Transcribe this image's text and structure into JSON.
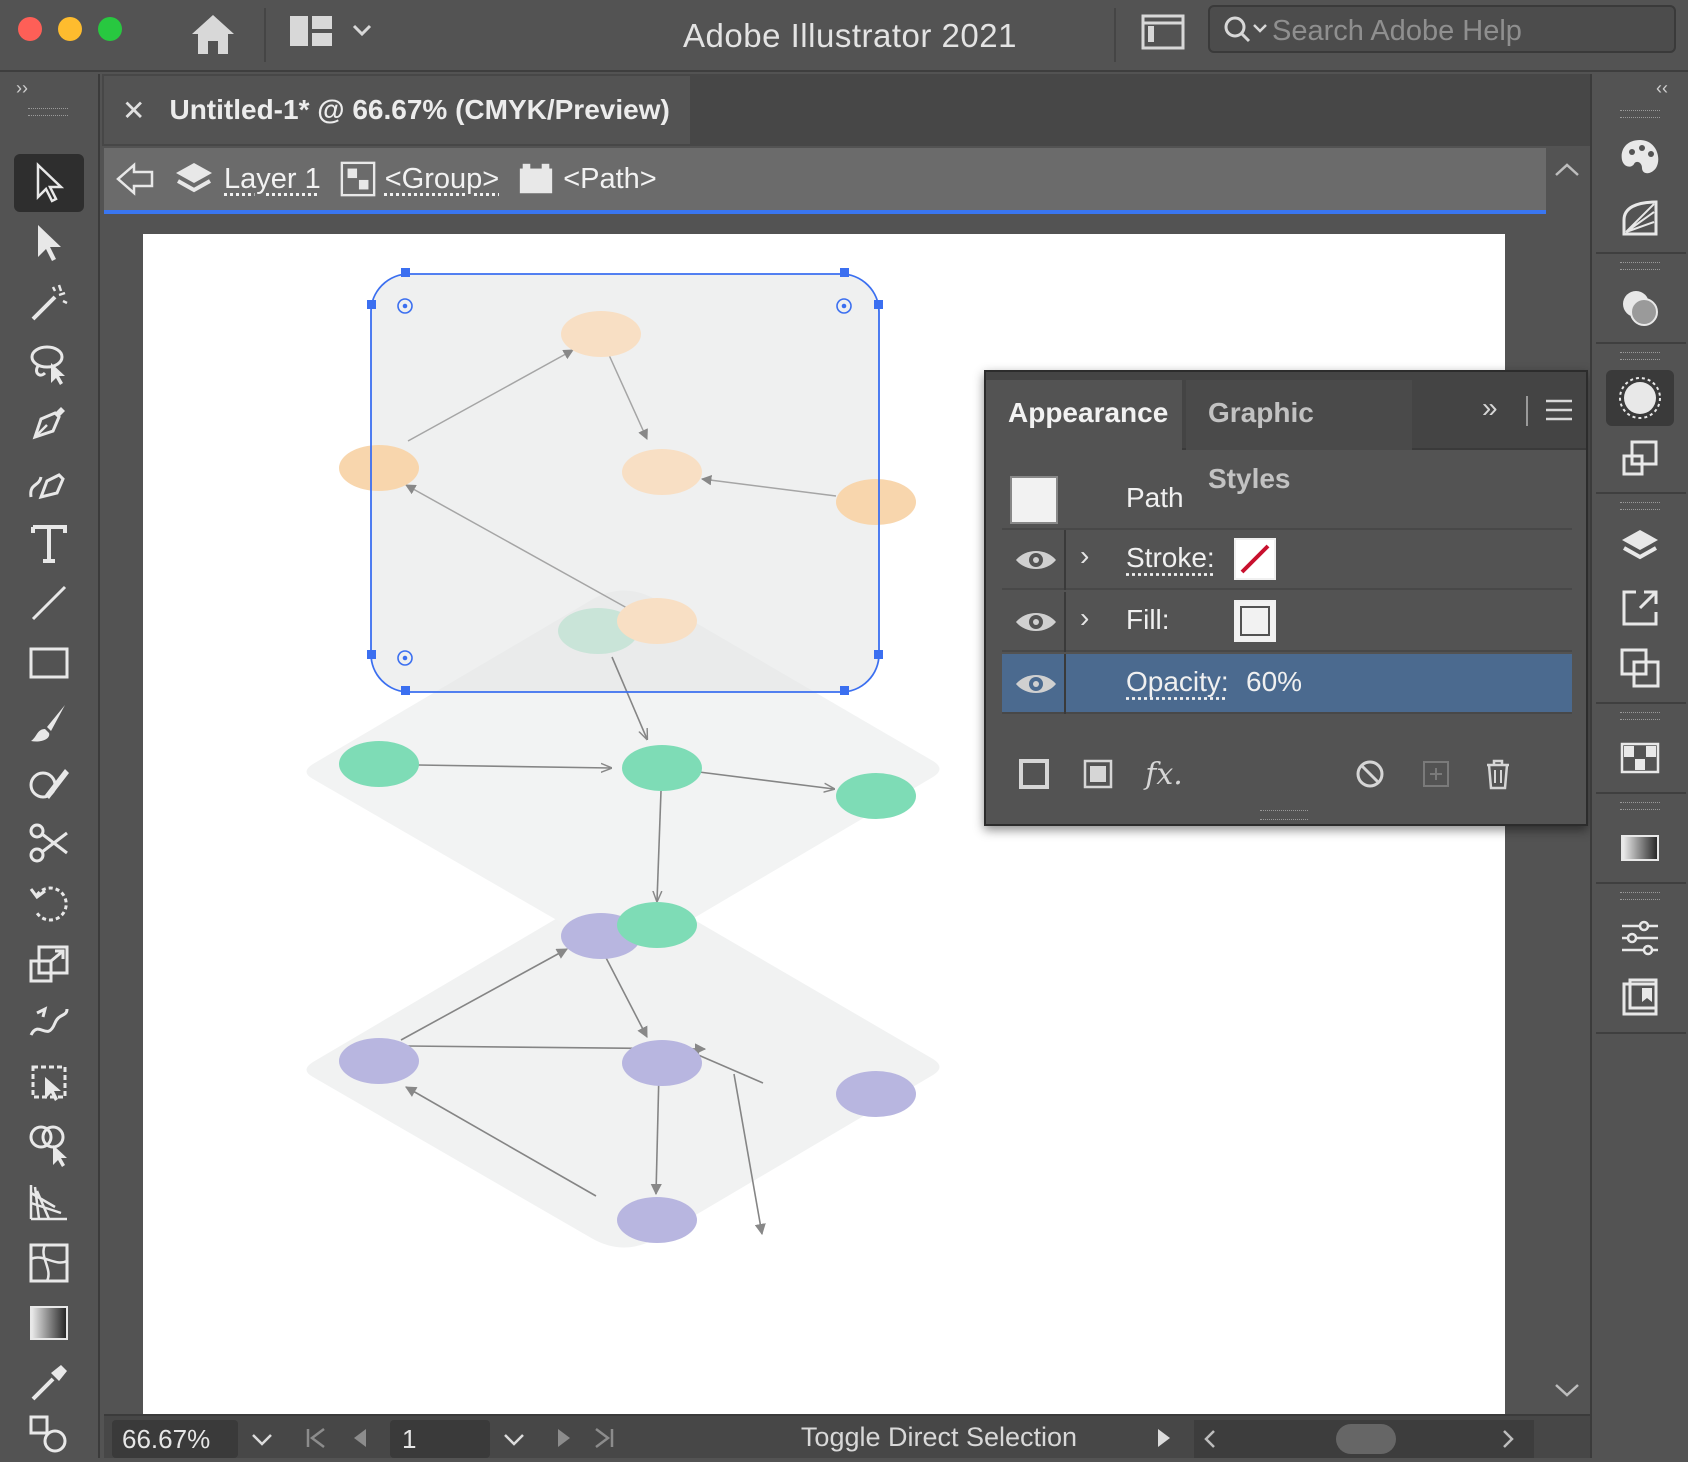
{
  "app": {
    "title": "Adobe Illustrator 2021"
  },
  "help_search": {
    "placeholder": "Search Adobe Help"
  },
  "document": {
    "tab_title": "Untitled-1* @ 66.67% (CMYK/Preview)"
  },
  "breadcrumb": {
    "layer": "Layer 1",
    "group": "<Group>",
    "path": "<Path>"
  },
  "appearance_panel": {
    "tabs": [
      "Appearance",
      "Graphic Styles"
    ],
    "active_tab": "Appearance",
    "object_label": "Path",
    "rows": [
      {
        "label": "Stroke:",
        "swatch": "none"
      },
      {
        "label": "Fill:",
        "swatch": "#f2f2f2"
      },
      {
        "label": "Opacity:",
        "value": "60%",
        "highlighted": true
      }
    ]
  },
  "status_bar": {
    "zoom": "66.67%",
    "page": "1",
    "status_text": "Toggle Direct Selection"
  },
  "colors": {
    "ui_bg": "#535353",
    "accent_blue": "#3a76f0",
    "highlight_row": "#4b6a8f",
    "node_orange": "#f8d6ad",
    "node_green": "#7edcb6",
    "node_purple": "#b8b6e0",
    "plane_gray": "#f1f2f2"
  },
  "left_tools": [
    "selection-tool",
    "direct-selection-tool",
    "magic-wand-tool",
    "lasso-tool",
    "pen-tool",
    "curvature-tool",
    "type-tool",
    "line-segment-tool",
    "rectangle-tool",
    "paintbrush-tool",
    "shaper-tool",
    "scissors-tool",
    "rotate-tool",
    "scale-tool",
    "warp-tool",
    "free-transform-tool",
    "shape-builder-tool",
    "perspective-grid-tool",
    "mesh-tool",
    "gradient-tool",
    "eyedropper-tool",
    "blend-tool"
  ],
  "right_dock_panels": [
    "color-panel",
    "color-guide-panel",
    "transparency-panel",
    "appearance-panel",
    "transform-panel",
    "layers-panel",
    "export-panel",
    "pathfinder-panel",
    "swatches-panel",
    "gradient-panel",
    "properties-panel",
    "libraries-panel"
  ]
}
